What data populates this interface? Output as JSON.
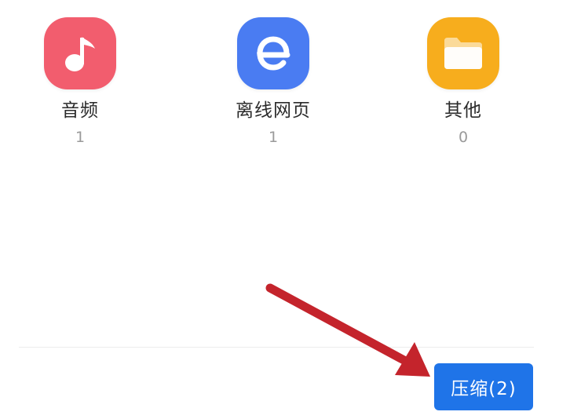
{
  "categories": [
    {
      "label": "音频",
      "count": "1",
      "icon": "music-note-icon",
      "color": "#f25d6e"
    },
    {
      "label": "离线网页",
      "count": "1",
      "icon": "browser-e-icon",
      "color": "#4a7cf2"
    },
    {
      "label": "其他",
      "count": "0",
      "icon": "folder-icon",
      "color": "#f7ad1d"
    }
  ],
  "compress_button": {
    "label": "压缩(2)",
    "color": "#1f74e8"
  },
  "annotation_arrow_color": "#c4242c"
}
